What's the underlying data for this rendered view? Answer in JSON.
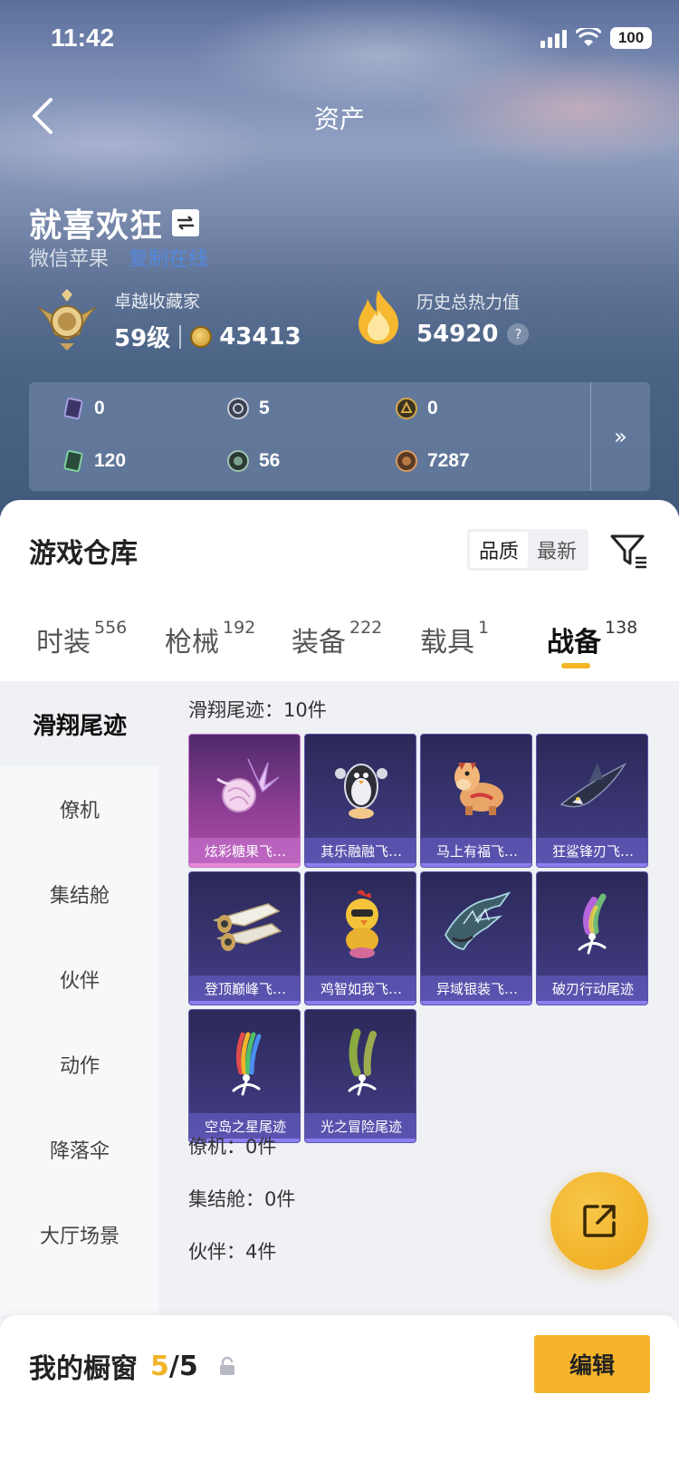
{
  "status_bar": {
    "time": "11:42",
    "battery": "100"
  },
  "header": {
    "title": "资产"
  },
  "profile": {
    "nickname": "就喜欢狂",
    "platform": "微信苹果",
    "online_status": "复制在线"
  },
  "collector": {
    "title": "卓越收藏家",
    "level": "59级",
    "points": "43413"
  },
  "heat": {
    "label": "历史总热力值",
    "value": "54920",
    "help": "?"
  },
  "currencies": [
    {
      "icon": "purple-card-icon",
      "value": "0"
    },
    {
      "icon": "silver-coin-icon",
      "value": "5"
    },
    {
      "icon": "gold-emblem-icon",
      "value": "0"
    },
    {
      "icon": "green-card-icon",
      "value": "120"
    },
    {
      "icon": "jade-coin-icon",
      "value": "56"
    },
    {
      "icon": "bronze-coin-icon",
      "value": "7287"
    }
  ],
  "currency_more": "»",
  "warehouse": {
    "title": "游戏仓库",
    "sort_quality": "品质",
    "sort_newest": "最新"
  },
  "tabs": [
    {
      "label": "时装",
      "count": "556"
    },
    {
      "label": "枪械",
      "count": "192"
    },
    {
      "label": "装备",
      "count": "222"
    },
    {
      "label": "载具",
      "count": "1"
    },
    {
      "label": "战备",
      "count": "138"
    }
  ],
  "side_nav": [
    "滑翔尾迹",
    "僚机",
    "集结舱",
    "伙伴",
    "动作",
    "降落伞",
    "大厅场景"
  ],
  "sections": {
    "glide_trails": "滑翔尾迹：10件",
    "wingman": "僚机：0件",
    "assembly_pod": "集结舱：0件",
    "partner": "伙伴：4件"
  },
  "items": [
    {
      "name": "炫彩糖果飞…",
      "art": "candy-glider-icon"
    },
    {
      "name": "其乐融融飞…",
      "art": "penguin-glider-icon"
    },
    {
      "name": "马上有福飞…",
      "art": "horse-glider-icon"
    },
    {
      "name": "狂鲨锋刃飞…",
      "art": "shark-glider-icon"
    },
    {
      "name": "登顶巅峰飞…",
      "art": "jet-glider-icon"
    },
    {
      "name": "鸡智如我飞…",
      "art": "chicken-glider-icon"
    },
    {
      "name": "异域银装飞…",
      "art": "dragon-glider-icon"
    },
    {
      "name": "破刃行动尾迹",
      "art": "smoke-trail-icon"
    },
    {
      "name": "空岛之星尾迹",
      "art": "rainbow-trail-icon"
    },
    {
      "name": "光之冒险尾迹",
      "art": "green-trail-icon"
    }
  ],
  "showcase": {
    "title": "我的橱窗",
    "used": "5",
    "total": "/5",
    "edit_label": "编辑"
  },
  "colors": {
    "accent": "#f5b42c",
    "card_purple": "#3a3675",
    "card_pink": "#8d3d93"
  }
}
